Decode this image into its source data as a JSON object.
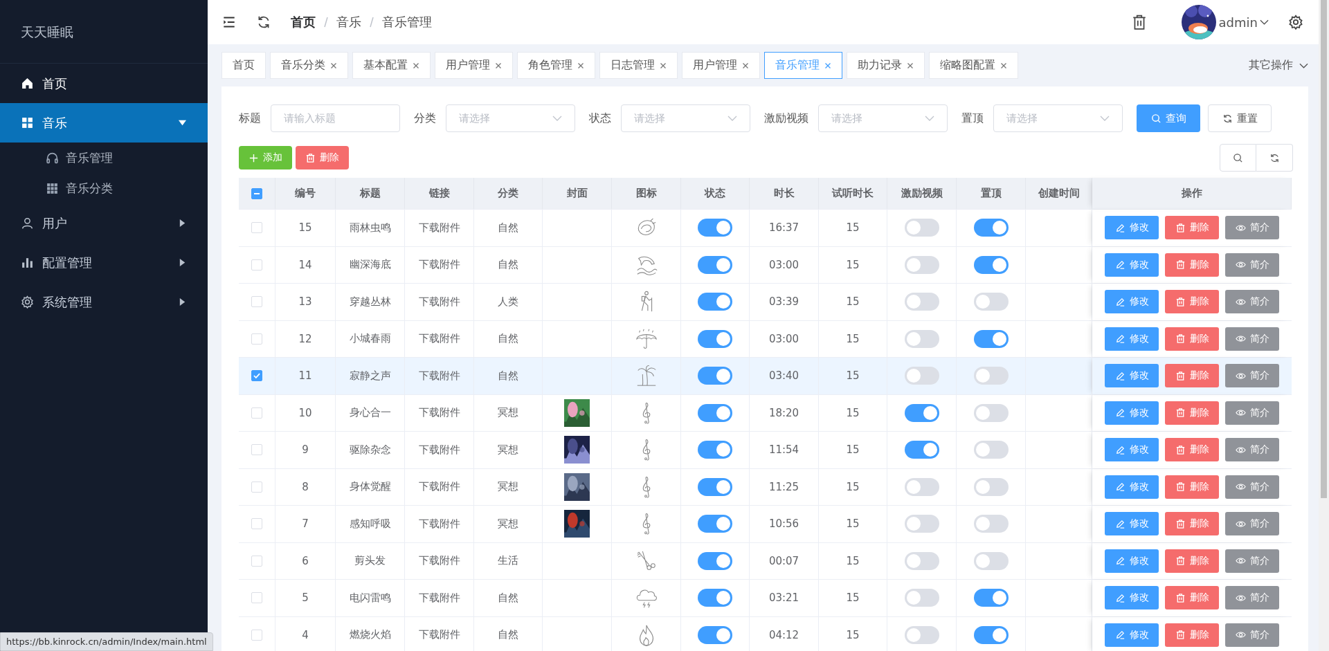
{
  "sidebar": {
    "logo": "天天睡眠",
    "items": [
      {
        "label": "首页",
        "kind": "home",
        "selected": false
      },
      {
        "label": "音乐",
        "kind": "grid",
        "selected": true,
        "expanded": true,
        "children": [
          {
            "label": "音乐管理",
            "kind": "headphones",
            "selected": false
          },
          {
            "label": "音乐分类",
            "kind": "dots",
            "selected": false
          }
        ]
      },
      {
        "label": "用户",
        "kind": "user",
        "selected": false,
        "expanded": false
      },
      {
        "label": "配置管理",
        "kind": "chart",
        "selected": false,
        "expanded": false
      },
      {
        "label": "系统管理",
        "kind": "gear",
        "selected": false,
        "expanded": false
      }
    ]
  },
  "header": {
    "breadcrumb": [
      "首页",
      "音乐",
      "音乐管理"
    ],
    "user": "admin"
  },
  "tabs": [
    {
      "label": "首页",
      "closable": false,
      "selected": false
    },
    {
      "label": "音乐分类",
      "closable": true,
      "selected": false
    },
    {
      "label": "基本配置",
      "closable": true,
      "selected": false
    },
    {
      "label": "用户管理",
      "closable": true,
      "selected": false
    },
    {
      "label": "角色管理",
      "closable": true,
      "selected": false
    },
    {
      "label": "日志管理",
      "closable": true,
      "selected": false
    },
    {
      "label": "用户管理",
      "closable": true,
      "selected": false
    },
    {
      "label": "音乐管理",
      "closable": true,
      "selected": true
    },
    {
      "label": "助力记录",
      "closable": true,
      "selected": false
    },
    {
      "label": "缩略图配置",
      "closable": true,
      "selected": false
    }
  ],
  "other_actions": "其它操作",
  "filters": [
    {
      "label": "标题",
      "kind": "input",
      "placeholder": "请输入标题"
    },
    {
      "label": "分类",
      "kind": "select",
      "placeholder": "请选择"
    },
    {
      "label": "状态",
      "kind": "select",
      "placeholder": "请选择"
    },
    {
      "label": "激励视频",
      "kind": "select",
      "placeholder": "请选择"
    },
    {
      "label": "置顶",
      "kind": "select",
      "placeholder": "请选择"
    }
  ],
  "filter_buttons": [
    "查询",
    "重置"
  ],
  "toolbar_buttons": [
    "添加",
    "删除"
  ],
  "table": {
    "header_checkbox_indeterminate": true,
    "columns": [
      "编号",
      "标题",
      "链接",
      "分类",
      "封面",
      "图标",
      "状态",
      "时长",
      "试听时长",
      "激励视频",
      "置顶",
      "创建时间",
      "操作"
    ],
    "rows": [
      {
        "checked": false,
        "id": "15",
        "title": "雨林虫鸣",
        "link": "下载附件",
        "category": "自然",
        "icon": {
          "kind": "shell"
        },
        "status": true,
        "duration": "16:37",
        "trial": "15",
        "incentive": false,
        "pinned": true,
        "actions": [
          "修改",
          "删除",
          "简介"
        ]
      },
      {
        "checked": false,
        "id": "14",
        "title": "幽深海底",
        "link": "下载附件",
        "category": "自然",
        "icon": {
          "kind": "dolphin"
        },
        "status": true,
        "duration": "03:00",
        "trial": "15",
        "incentive": false,
        "pinned": true,
        "actions": [
          "修改",
          "删除",
          "简介"
        ]
      },
      {
        "checked": false,
        "id": "13",
        "title": "穿越丛林",
        "link": "下载附件",
        "category": "人类",
        "icon": {
          "kind": "hiker"
        },
        "status": true,
        "duration": "03:39",
        "trial": "15",
        "incentive": false,
        "pinned": false,
        "actions": [
          "修改",
          "删除",
          "简介"
        ]
      },
      {
        "checked": false,
        "id": "12",
        "title": "小城春雨",
        "link": "下载附件",
        "category": "自然",
        "icon": {
          "kind": "umbrella"
        },
        "status": true,
        "duration": "03:00",
        "trial": "15",
        "incentive": false,
        "pinned": true,
        "actions": [
          "修改",
          "删除",
          "简介"
        ]
      },
      {
        "checked": true,
        "id": "11",
        "title": "寂静之声",
        "link": "下载附件",
        "category": "自然",
        "icon": {
          "kind": "palm"
        },
        "status": true,
        "duration": "03:40",
        "trial": "15",
        "incentive": false,
        "pinned": false,
        "actions": [
          "修改",
          "删除",
          "简介"
        ]
      },
      {
        "checked": false,
        "id": "10",
        "title": "身心合一",
        "link": "下载附件",
        "category": "冥想",
        "icon": {
          "kind": "clef"
        },
        "status": true,
        "duration": "18:20",
        "trial": "15",
        "incentive": true,
        "pinned": false,
        "actions": [
          "修改",
          "删除",
          "简介"
        ]
      },
      {
        "checked": false,
        "id": "9",
        "title": "驱除杂念",
        "link": "下载附件",
        "category": "冥想",
        "icon": {
          "kind": "clef"
        },
        "status": true,
        "duration": "11:54",
        "trial": "15",
        "incentive": true,
        "pinned": false,
        "actions": [
          "修改",
          "删除",
          "简介"
        ]
      },
      {
        "checked": false,
        "id": "8",
        "title": "身体觉醒",
        "link": "下载附件",
        "category": "冥想",
        "icon": {
          "kind": "clef"
        },
        "status": true,
        "duration": "11:25",
        "trial": "15",
        "incentive": false,
        "pinned": false,
        "actions": [
          "修改",
          "删除",
          "简介"
        ]
      },
      {
        "checked": false,
        "id": "7",
        "title": "感知呼吸",
        "link": "下载附件",
        "category": "冥想",
        "icon": {
          "kind": "clef"
        },
        "status": true,
        "duration": "10:56",
        "trial": "15",
        "incentive": false,
        "pinned": false,
        "actions": [
          "修改",
          "删除",
          "简介"
        ]
      },
      {
        "checked": false,
        "id": "6",
        "title": "剪头发",
        "link": "下载附件",
        "category": "生活",
        "icon": {
          "kind": "scissors"
        },
        "status": true,
        "duration": "00:07",
        "trial": "15",
        "incentive": false,
        "pinned": false,
        "actions": [
          "修改",
          "删除",
          "简介"
        ]
      },
      {
        "checked": false,
        "id": "5",
        "title": "电闪雷鸣",
        "link": "下载附件",
        "category": "自然",
        "icon": {
          "kind": "thunder"
        },
        "status": true,
        "duration": "03:21",
        "trial": "15",
        "incentive": false,
        "pinned": true,
        "actions": [
          "修改",
          "删除",
          "简介"
        ]
      },
      {
        "checked": false,
        "id": "4",
        "title": "燃烧火焰",
        "link": "下载附件",
        "category": "自然",
        "icon": {
          "kind": "flame"
        },
        "status": true,
        "duration": "04:12",
        "trial": "15",
        "incentive": false,
        "pinned": true,
        "actions": [
          "修改",
          "删除",
          "简介"
        ]
      }
    ]
  },
  "status_url": "https://bb.kinrock.cn/admin/Index/main.html"
}
